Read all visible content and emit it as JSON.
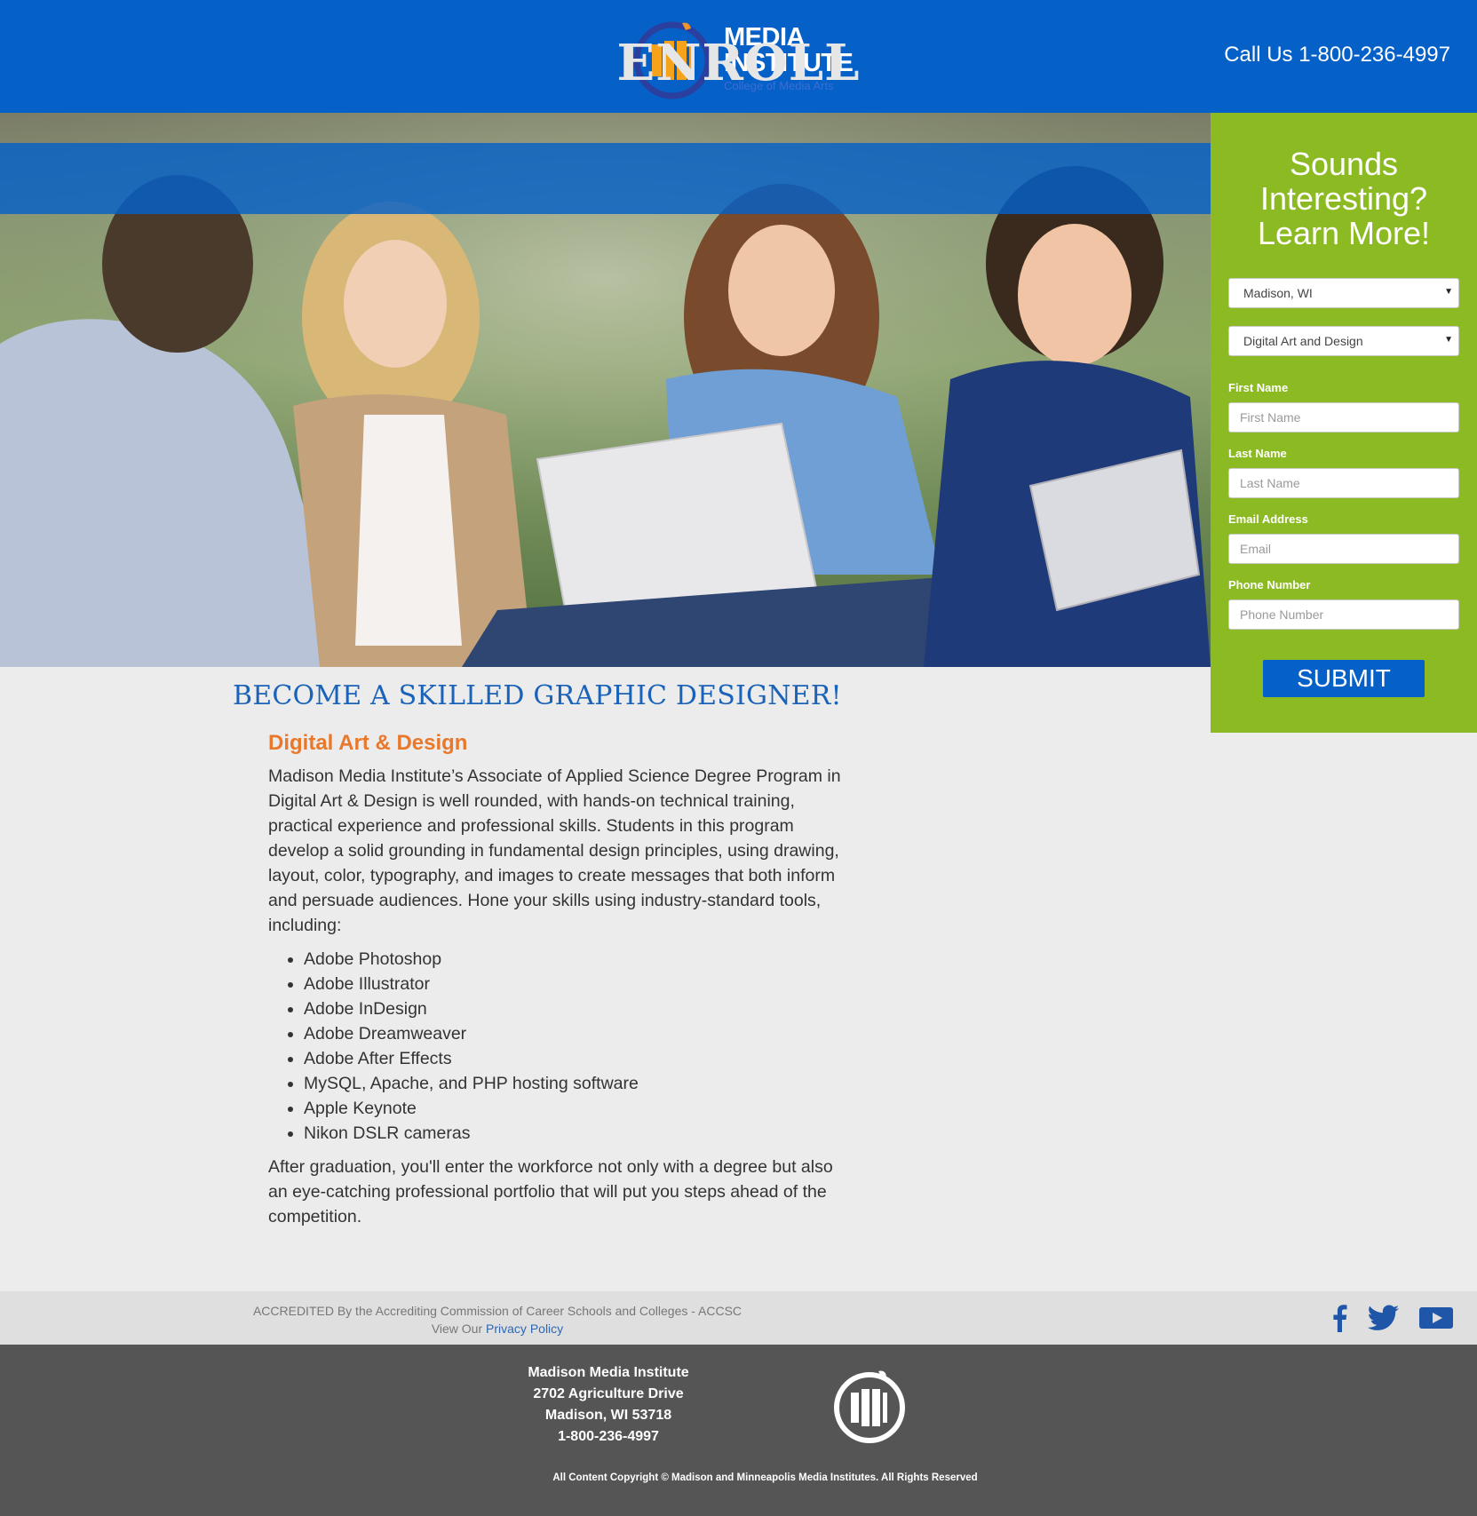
{
  "header": {
    "logo_line1": "MEDIA",
    "logo_line2": "INSTITUTE",
    "logo_sub": "College of Media Arts",
    "call_text": "Call Us 1-800-236-4997"
  },
  "hero": {
    "banner": "ENROLL"
  },
  "form": {
    "title_line1": "Sounds",
    "title_line2": "Interesting?",
    "title_line3": "Learn More!",
    "campus_value": "Madison, WI",
    "program_value": "Digital Art and Design",
    "first_name_label": "First Name",
    "first_name_placeholder": "First Name",
    "last_name_label": "Last Name",
    "last_name_placeholder": "Last Name",
    "email_label": "Email Address",
    "email_placeholder": "Email",
    "phone_label": "Phone Number",
    "phone_placeholder": "Phone Number",
    "submit_label": "SUBMIT"
  },
  "main": {
    "title": "BECOME A SKILLED GRAPHIC DESIGNER!",
    "program_title": "Digital Art & Design",
    "intro": "Madison Media Institute’s Associate of Applied Science Degree Program in Digital Art & Design is well rounded, with hands-on technical training, practical experience and professional skills. Students in this program develop a solid grounding in fundamental design principles, using drawing, layout, color, typography, and images to create messages that both inform and persuade audiences. Hone your skills using industry-standard tools, including:",
    "tools": [
      "Adobe Photoshop",
      "Adobe Illustrator",
      "Adobe InDesign",
      "Adobe Dreamweaver",
      "Adobe After Effects",
      "MySQL, Apache, and PHP hosting software",
      "Apple Keynote",
      "Nikon DSLR cameras"
    ],
    "outro": "After graduation, you'll enter the workforce not only with a degree but also an eye-catching professional portfolio that will put you steps ahead of the competition."
  },
  "footer": {
    "accreditation": "ACCREDITED By the Accrediting Commission of Career Schools and Colleges - ACCSC",
    "privacy_prefix": "View Our",
    "privacy_link": "Privacy Policy",
    "address_name": "Madison Media Institute",
    "address_street": "2702 Agriculture Drive",
    "address_city": "Madison, WI 53718",
    "address_phone": "1-800-236-4997",
    "copyright": "All Content Copyright © Madison and Minneapolis Media Institutes. All Rights Reserved"
  },
  "colors": {
    "brand_blue": "#0560c8",
    "form_green": "#8cba23",
    "accent_orange": "#e8782b",
    "footer_gray": "#555555"
  },
  "icons": [
    "facebook-icon",
    "twitter-icon",
    "youtube-icon",
    "dropdown-caret-icon"
  ]
}
